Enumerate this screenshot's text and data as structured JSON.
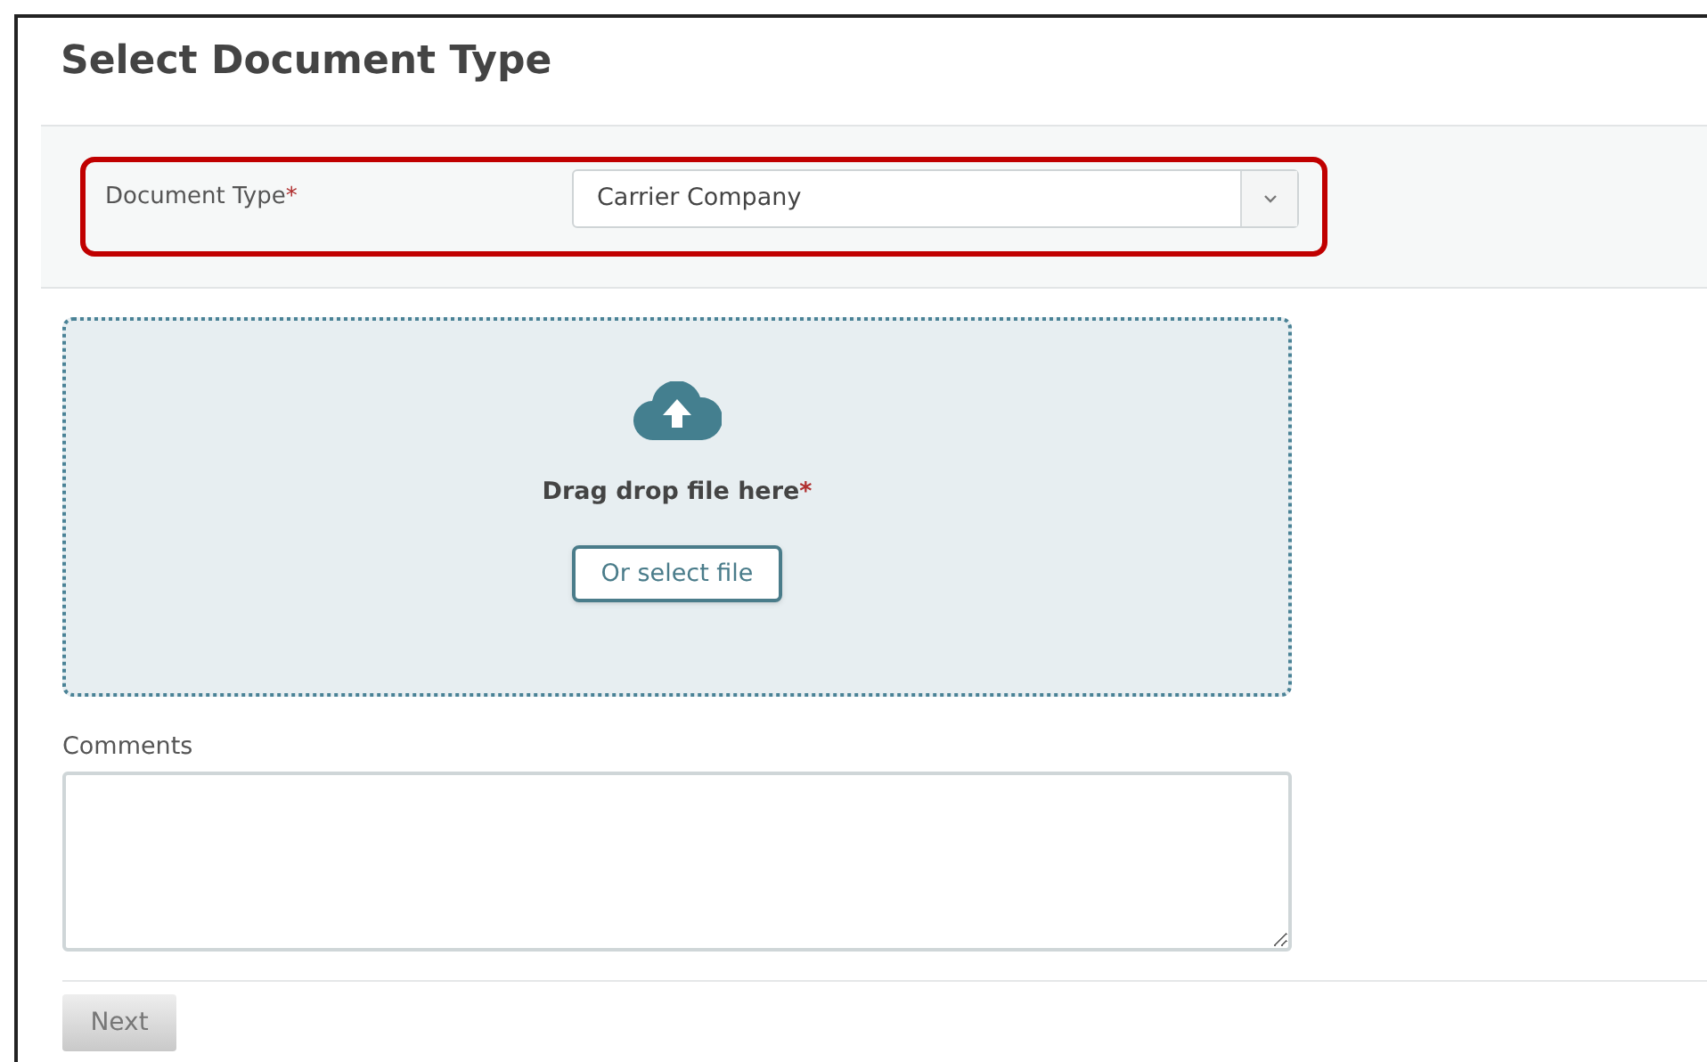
{
  "title": "Select Document Type",
  "document_type": {
    "label": "Document Type",
    "required_mark": "*",
    "value": "Carrier Company",
    "highlighted": true
  },
  "dropzone": {
    "text": "Drag drop file here",
    "required_mark": "*",
    "button": "Or select file"
  },
  "comments": {
    "label": "Comments"
  },
  "next_button": {
    "label": "Next",
    "disabled": true
  }
}
